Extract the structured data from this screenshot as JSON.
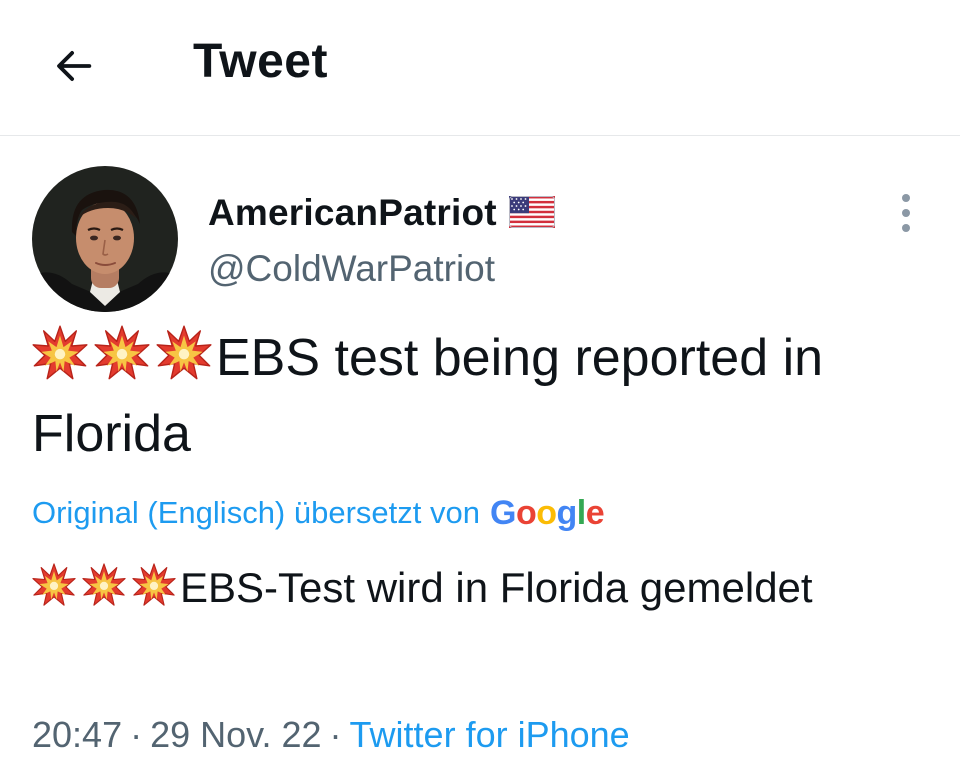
{
  "header": {
    "back_icon": "arrow-left-icon",
    "title": "Tweet"
  },
  "author": {
    "display_name": "AmericanPatriot",
    "flag_icon": "us-flag-icon",
    "handle": "@ColdWarPatriot",
    "more_icon": "more-vertical-icon"
  },
  "tweet": {
    "emoji_icon": "collision-burst-icon",
    "emoji_count": 3,
    "text": "EBS test being reported in Florida"
  },
  "translation": {
    "label": "Original (Englisch) übersetzt von",
    "provider_letters": [
      "G",
      "o",
      "o",
      "g",
      "l",
      "e"
    ],
    "provider_colors": [
      "#4285F4",
      "#EA4335",
      "#FBBC05",
      "#4285F4",
      "#34A853",
      "#EA4335"
    ],
    "text": "EBS-Test wird in Florida gemeldet"
  },
  "meta": {
    "time": "20:47",
    "separator": "·",
    "date": "29 Nov. 22",
    "source": "Twitter for iPhone"
  },
  "colors": {
    "link": "#1d9bf0",
    "secondary_text": "#536471",
    "primary_text": "#0f1419",
    "divider": "#e6e8ea"
  }
}
